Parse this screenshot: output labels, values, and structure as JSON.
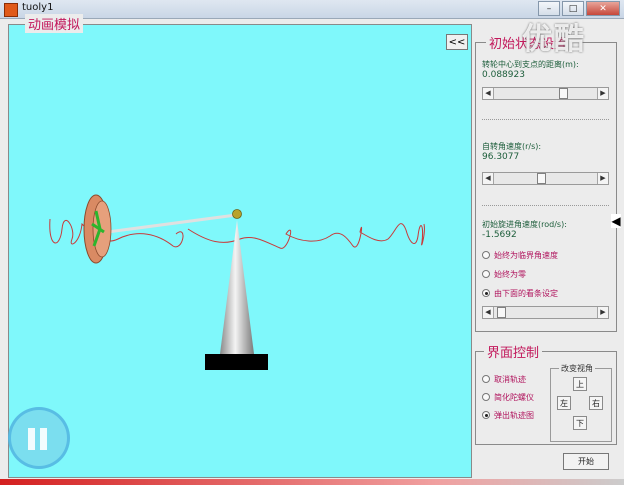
{
  "window": {
    "title": "tuoly1",
    "buttons": [
      "–",
      "□",
      "✕"
    ]
  },
  "watermark": "优酷",
  "animation_panel": {
    "title": "动画模拟",
    "collapse_label": "<<"
  },
  "initial_panel": {
    "title": "初始状态设置",
    "distance": {
      "label": "转轮中心到支点的距离(m):",
      "value": "0.088923",
      "slider_fraction": 0.62
    },
    "spin_speed": {
      "label": "自转角速度(r/s):",
      "value": "96.3077",
      "slider_fraction": 0.46
    },
    "precession": {
      "label": "初始旋进角速度(rod/s):",
      "value": "-1.5692",
      "options": [
        {
          "label": "始终为临界角速度",
          "selected": false
        },
        {
          "label": "始终为零",
          "selected": false
        },
        {
          "label": "由下面的看条设定",
          "selected": true
        }
      ],
      "slider_fraction": 0.08
    }
  },
  "ui_panel": {
    "title": "界面控制",
    "options": [
      {
        "label": "取消轨迹",
        "selected": false
      },
      {
        "label": "简化陀螺仪",
        "selected": false
      },
      {
        "label": "弹出轨迹图",
        "selected": true
      }
    ],
    "view_group": {
      "title": "改变视角",
      "up": "上",
      "down": "下",
      "left": "左",
      "right": "右"
    }
  },
  "start_button": "开始",
  "colors": {
    "scene_bg": "#7ff8fb",
    "accent_label": "#c2185b",
    "wheel": "#d98a63",
    "trace": "#c93a3a"
  }
}
